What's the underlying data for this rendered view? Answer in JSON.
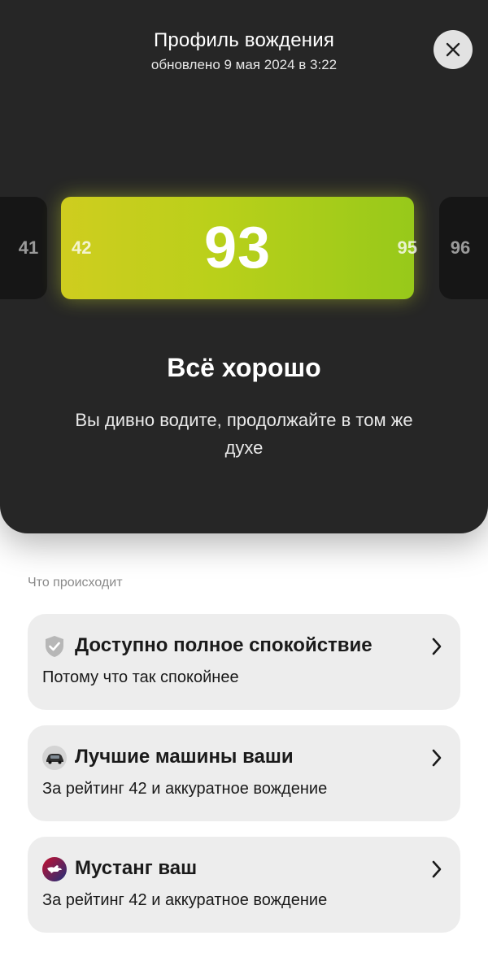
{
  "header": {
    "title": "Профиль вождения",
    "updated": "обновлено 9 мая 2024 в 3:22"
  },
  "rating": {
    "prev_far": "41",
    "prev_near": "42",
    "current": "93",
    "next_near": "95",
    "next_far": "96",
    "gradient_colors": [
      "#cfcd1f",
      "#97c91a"
    ]
  },
  "status": {
    "title": "Всё хорошо",
    "description": "Вы дивно водите, продолжайте в том же духе"
  },
  "section": {
    "label": "Что происходит"
  },
  "items": [
    {
      "icon": "shield-check-icon",
      "title": "Доступно полное спокойствие",
      "subtitle": "Потому что так спокойнее"
    },
    {
      "icon": "car-icon",
      "title": "Лучшие машины ваши",
      "subtitle": "За рейтинг 42 и аккуратное вождение"
    },
    {
      "icon": "mustang-logo-icon",
      "title": "Мустанг ваш",
      "subtitle": "За рейтинг 42 и аккуратное вождение"
    }
  ]
}
